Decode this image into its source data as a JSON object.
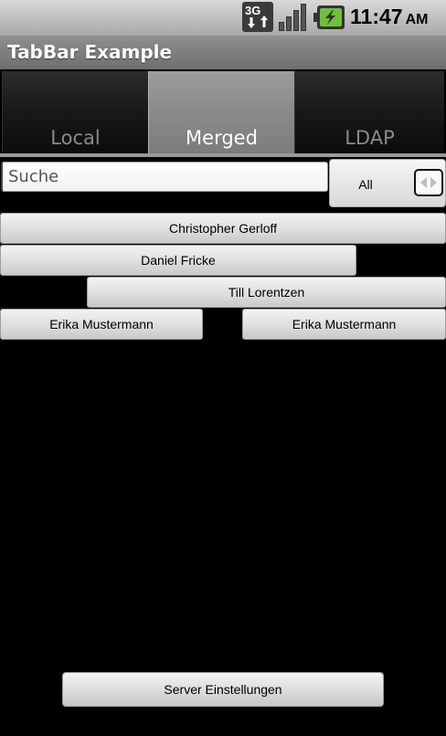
{
  "status_bar": {
    "network": "3G",
    "network_icon": "network-3g-icon",
    "signal_icon": "signal-strength-icon",
    "battery_icon": "battery-charging-icon",
    "time": "11:47",
    "ampm": "AM"
  },
  "app": {
    "title": "TabBar Example"
  },
  "tabs": [
    {
      "label": "Local",
      "selected": false
    },
    {
      "label": "Merged",
      "selected": true
    },
    {
      "label": "LDAP",
      "selected": false
    }
  ],
  "search": {
    "placeholder": "Suche",
    "value": ""
  },
  "filter": {
    "selected": "All",
    "icon": "spinner-arrows-icon"
  },
  "contacts": [
    {
      "name": "Christopher Gerloff"
    },
    {
      "name": "Daniel Fricke"
    },
    {
      "name": "Till Lorentzen"
    },
    {
      "name": "Erika Mustermann"
    },
    {
      "name": "Erika Mustermann"
    }
  ],
  "footer": {
    "server_settings_label": "Server Einstellungen"
  },
  "colors": {
    "background": "#000000",
    "selected_tab": "#8a8a8a",
    "title_bar": "#7a7a7a",
    "battery_green": "#6fc03a"
  }
}
